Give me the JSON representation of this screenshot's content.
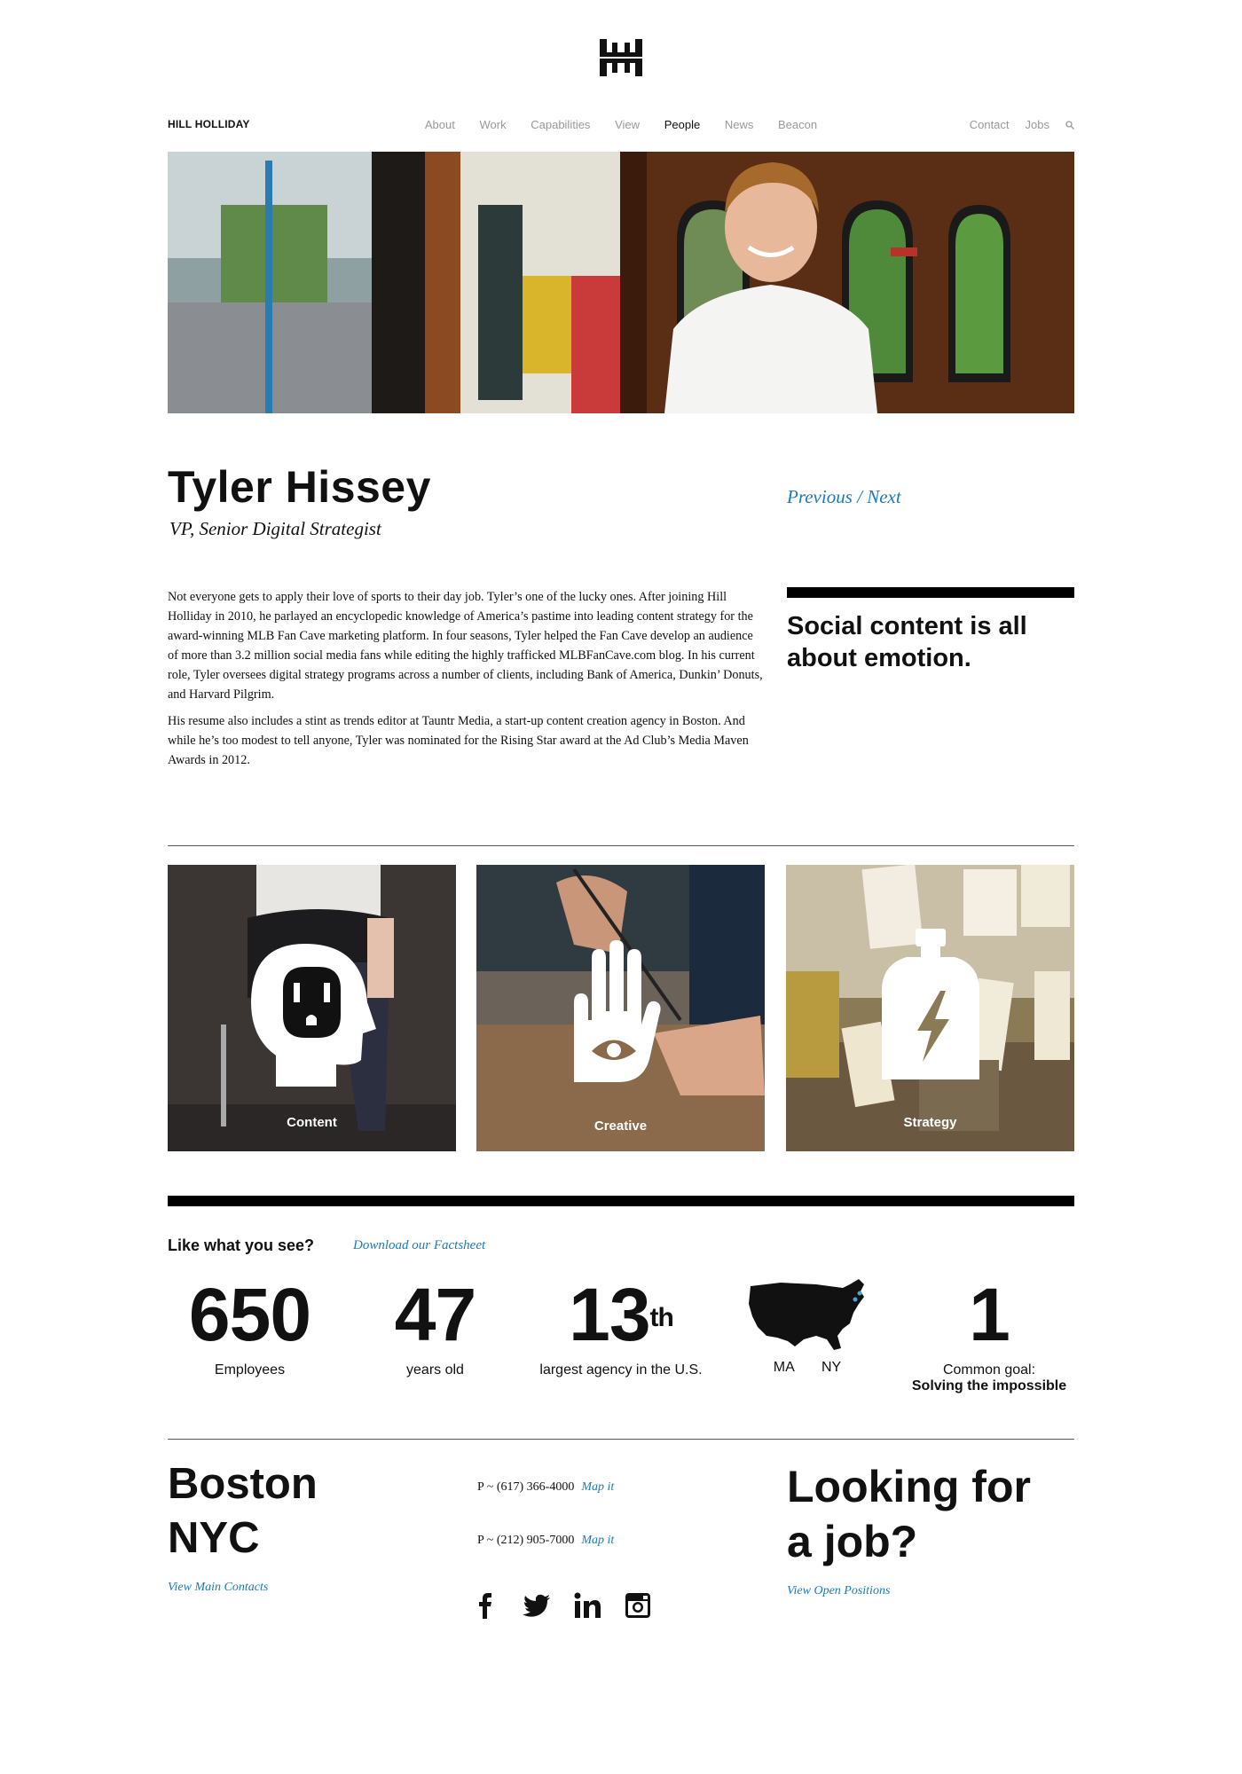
{
  "brand": "HILL HOLLIDAY",
  "nav": {
    "items": [
      "About",
      "Work",
      "Capabilities",
      "View",
      "People",
      "News",
      "Beacon"
    ],
    "active": "People",
    "right": [
      "Contact",
      "Jobs"
    ]
  },
  "profile": {
    "name": "Tyler Hissey",
    "title": "VP, Senior Digital Strategist",
    "prev_next": "Previous / Next",
    "bio": [
      "Not everyone gets to apply their love of sports to their day job. Tyler’s one of the lucky ones. After joining Hill Holliday in 2010, he parlayed an encyclopedic knowledge of America’s pastime into leading content strategy for the award-winning MLB Fan Cave marketing platform. In four seasons, Tyler helped the Fan Cave develop an audience of more than 3.2 million social media fans while editing the highly trafficked MLBFanCave.com blog. In his current role, Tyler oversees digital strategy programs across a number of clients, including Bank of America, Dunkin’ Donuts, and Harvard Pilgrim.",
      "His resume also includes a stint as trends editor at Tauntr Media, a start-up content creation agency in Boston. And while he’s too modest to tell anyone, Tyler was nominated for the Rising Star award at the Ad Club’s Media Maven Awards in 2012."
    ],
    "quote": "Social content is all about emotion."
  },
  "capabilities": [
    "Content",
    "Creative",
    "Strategy"
  ],
  "facts": {
    "heading": "Like what you see?",
    "factsheet_link": "Download our Factsheet",
    "stats": [
      {
        "num": "650",
        "label": "Employees"
      },
      {
        "num": "47",
        "label": "years old"
      },
      {
        "num": "13",
        "sup": "th",
        "label": "largest agency in the U.S."
      },
      {
        "label_a": "MA",
        "label_b": "NY"
      },
      {
        "num": "1",
        "label": "Common goal:",
        "label2": "Solving the impossible"
      }
    ]
  },
  "footer": {
    "city1": "Boston",
    "city2": "NYC",
    "contacts_link": "View Main Contacts",
    "phone1": "P ~ (617) 366-4000",
    "phone2": "P ~ (212) 905-7000",
    "map_link": "Map it",
    "jobs_heading_1": "Looking for",
    "jobs_heading_2": "a job?",
    "jobs_link": "View Open Positions"
  },
  "colors": {
    "link": "#1d7bb8",
    "text": "#111111",
    "nav_inactive": "#999999"
  }
}
